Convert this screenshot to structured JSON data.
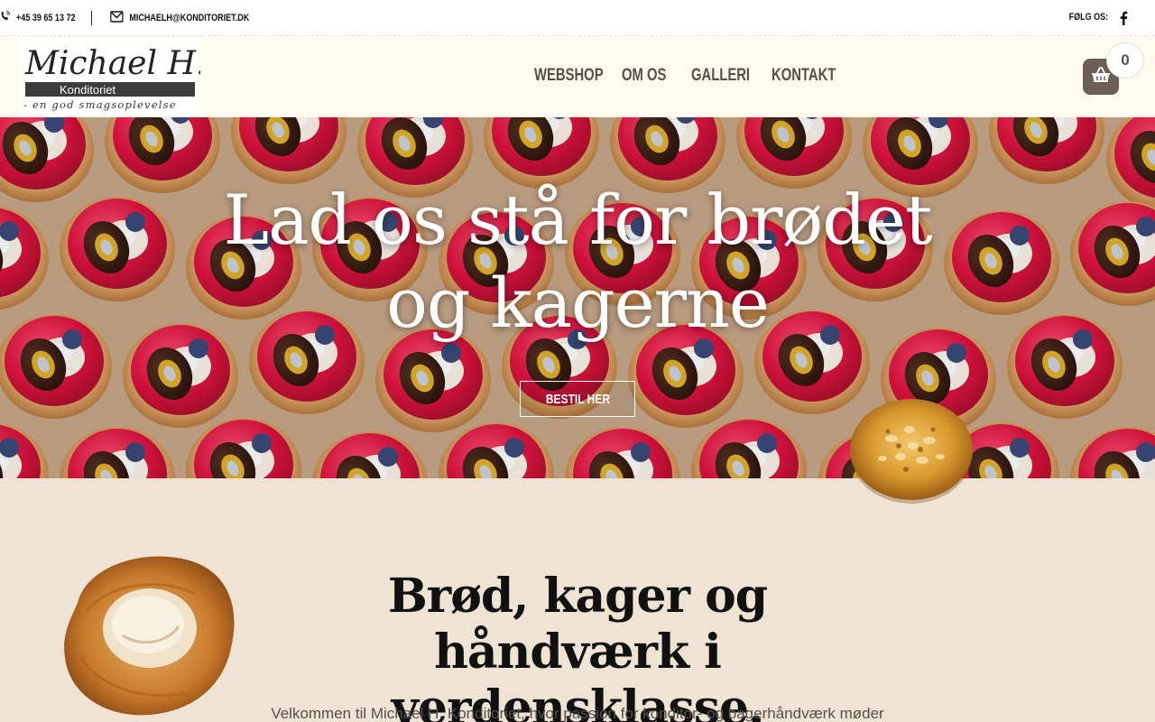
{
  "topbar": {
    "phone": "+45 39 65 13 72",
    "email": "MICHAELH@KONDITORIET.DK",
    "follow_label": "FØLG OS:",
    "icons": {
      "phone": "phone-ringing-icon",
      "email": "envelope-icon",
      "social": "facebook-icon"
    }
  },
  "logo": {
    "name": "Michael H.",
    "subtitle": "Konditoriet",
    "tagline": "- en god smagsoplevelse"
  },
  "nav": {
    "items": [
      {
        "label": "WEBSHOP"
      },
      {
        "label": "OM OS"
      },
      {
        "label": "GALLERI"
      },
      {
        "label": "KONTAKT"
      }
    ]
  },
  "cart": {
    "count": "0",
    "icon": "basket-icon"
  },
  "hero": {
    "title_line1": "Lad os stå for brødet",
    "title_line2": "og kagerne",
    "button": "BESTIL HER"
  },
  "intro": {
    "title_line1": "Brød, kager og håndværk i",
    "title_line2": "verdensklasse.",
    "text": "Velkommen til Michael H. Konditoriet, hvor passion for konditor- og bagerhåndværk møder"
  },
  "colors": {
    "topbar_bg": "#ffffff",
    "header_bg": "#fffaec",
    "page_bg": "#efe4d4",
    "nav_text": "#555049",
    "cart_bg": "#6b5f56"
  }
}
